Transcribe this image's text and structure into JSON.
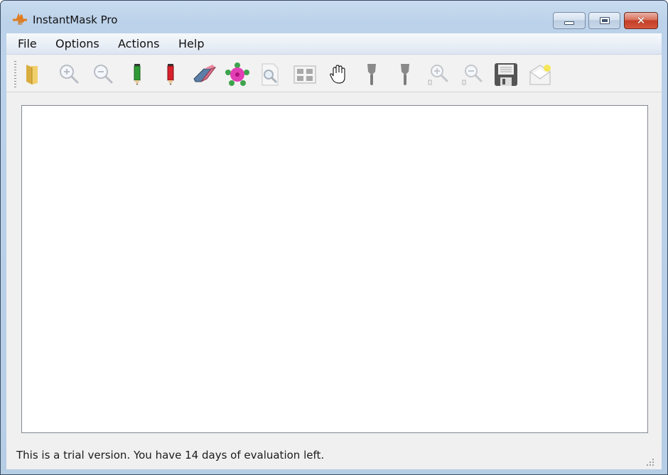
{
  "window": {
    "title": "InstantMask Pro",
    "app_icon": "instantmask-logo-icon",
    "caption_buttons": [
      {
        "name": "minimize",
        "icon": "minimize-icon"
      },
      {
        "name": "maximize",
        "icon": "maximize-icon"
      },
      {
        "name": "close",
        "icon": "close-icon",
        "glyph": "✕"
      }
    ]
  },
  "menu": {
    "items": [
      {
        "label": "File"
      },
      {
        "label": "Options"
      },
      {
        "label": "Actions"
      },
      {
        "label": "Help"
      }
    ]
  },
  "toolbar": {
    "tools": [
      {
        "name": "open",
        "icon": "folder-icon",
        "enabled": true
      },
      {
        "name": "zoom-in",
        "icon": "zoom-in-icon",
        "enabled": false
      },
      {
        "name": "zoom-out",
        "icon": "zoom-out-icon",
        "enabled": false
      },
      {
        "name": "keep-pencil",
        "icon": "green-pencil-icon",
        "enabled": true
      },
      {
        "name": "drop-pencil",
        "icon": "red-pencil-icon",
        "enabled": true
      },
      {
        "name": "eraser",
        "icon": "eraser-icon",
        "enabled": true
      },
      {
        "name": "flower",
        "icon": "flower-icon",
        "enabled": true
      },
      {
        "name": "preview",
        "icon": "document-magnifier-icon",
        "enabled": false
      },
      {
        "name": "grid-view",
        "icon": "grid-icon",
        "enabled": false
      },
      {
        "name": "pan",
        "icon": "hand-icon",
        "enabled": true
      },
      {
        "name": "brush-1",
        "icon": "brush-icon",
        "enabled": false
      },
      {
        "name": "brush-2",
        "icon": "brush-icon",
        "enabled": false
      },
      {
        "name": "background-zoom-in",
        "icon": "zoom-in-b-icon",
        "enabled": false
      },
      {
        "name": "background-zoom-out",
        "icon": "zoom-out-b-icon",
        "enabled": false
      },
      {
        "name": "save",
        "icon": "floppy-disk-icon",
        "enabled": true
      },
      {
        "name": "new-message",
        "icon": "envelope-star-icon",
        "enabled": false
      }
    ]
  },
  "status": {
    "text": "This is a trial version. You have 14 days of evaluation left."
  },
  "colors": {
    "frame": "#b6cde6",
    "client_bg": "#f0f0f0",
    "close_button": "#c33f27"
  }
}
